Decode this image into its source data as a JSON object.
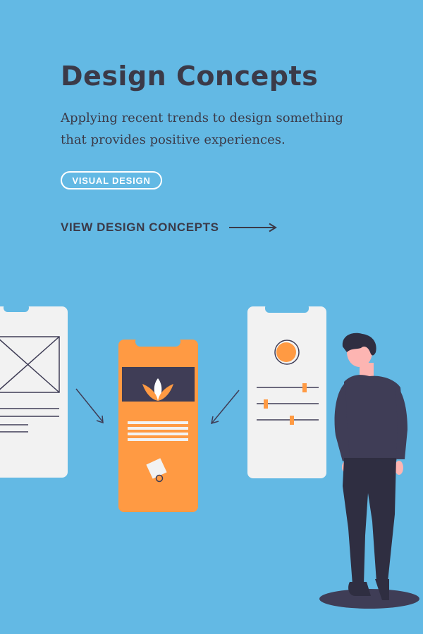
{
  "card": {
    "title": "Design Concepts",
    "subtitle": "Applying recent trends to design something that provides positive experiences.",
    "tag": "VISUAL DESIGN",
    "cta_label": "VIEW DESIGN CONCEPTS",
    "cta_icon": "arrow-right-icon"
  },
  "colors": {
    "background": "#63b9e4",
    "text_dark": "#3b3a48",
    "accent_orange": "#ff9a43",
    "phone_light": "#f2f2f2",
    "figure_dark": "#3f3d56",
    "skin": "#fdb5b2"
  },
  "illustration": {
    "name": "wireframe-to-design-illustration",
    "elements": [
      "wireframe-phone",
      "design-phone",
      "settings-phone",
      "standing-person"
    ]
  }
}
